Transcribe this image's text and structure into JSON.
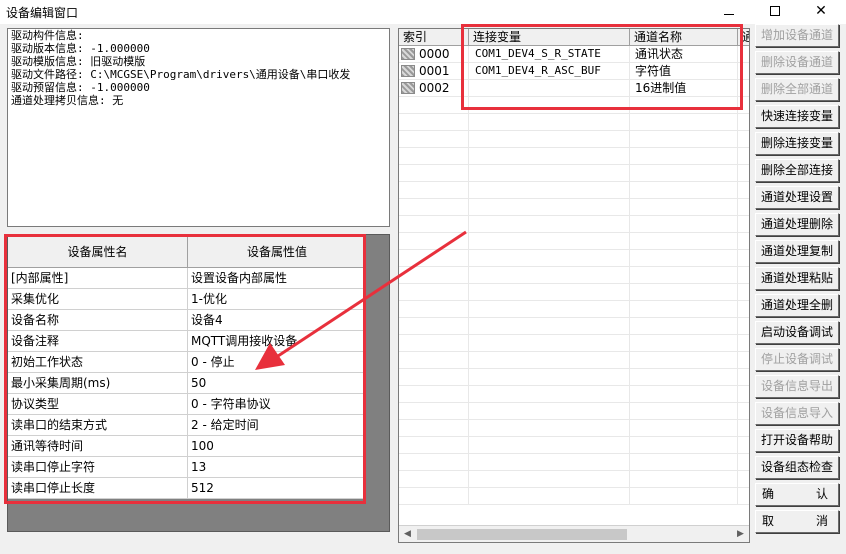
{
  "window": {
    "title": "设备编辑窗口",
    "minimize": "—",
    "close": "✕"
  },
  "info": {
    "lines": [
      "驱动构件信息:",
      "驱动版本信息: -1.000000",
      "驱动模版信息: 旧驱动模版",
      "驱动文件路径: C:\\MCGSE\\Program\\drivers\\通用设备\\串口收发",
      "驱动预留信息: -1.000000",
      "通道处理拷贝信息: 无"
    ]
  },
  "properties": {
    "header": {
      "name": "设备属性名",
      "value": "设备属性值"
    },
    "rows": [
      {
        "name": "[内部属性]",
        "value": "设置设备内部属性"
      },
      {
        "name": "采集优化",
        "value": "1-优化"
      },
      {
        "name": "设备名称",
        "value": "设备4"
      },
      {
        "name": "设备注释",
        "value": "MQTT调用接收设备"
      },
      {
        "name": "初始工作状态",
        "value": "0 - 停止"
      },
      {
        "name": "最小采集周期(ms)",
        "value": "50"
      },
      {
        "name": "协议类型",
        "value": "0 - 字符串协议"
      },
      {
        "name": "读串口的结束方式",
        "value": "2 - 给定时间"
      },
      {
        "name": "通讯等待时间",
        "value": "100"
      },
      {
        "name": "读串口停止字符",
        "value": "13"
      },
      {
        "name": "读串口停止长度",
        "value": "512"
      }
    ]
  },
  "channels": {
    "header": {
      "index": "索引",
      "variable": "连接变量",
      "name": "通道名称",
      "more": "通"
    },
    "rows": [
      {
        "index": "0000",
        "variable": "COM1_DEV4_S_R_STATE",
        "name": "通讯状态"
      },
      {
        "index": "0001",
        "variable": "COM1_DEV4_R_ASC_BUF",
        "name": "字符值"
      },
      {
        "index": "0002",
        "variable": "",
        "name": "16进制值"
      }
    ]
  },
  "buttons": [
    {
      "label": "增加设备通道",
      "enabled": false
    },
    {
      "label": "删除设备通道",
      "enabled": false
    },
    {
      "label": "删除全部通道",
      "enabled": false
    },
    {
      "label": "快速连接变量",
      "enabled": true
    },
    {
      "label": "删除连接变量",
      "enabled": true
    },
    {
      "label": "删除全部连接",
      "enabled": true
    },
    {
      "label": "通道处理设置",
      "enabled": true
    },
    {
      "label": "通道处理删除",
      "enabled": true
    },
    {
      "label": "通道处理复制",
      "enabled": true
    },
    {
      "label": "通道处理粘贴",
      "enabled": true
    },
    {
      "label": "通道处理全删",
      "enabled": true
    },
    {
      "label": "启动设备调试",
      "enabled": true
    },
    {
      "label": "停止设备调试",
      "enabled": false
    },
    {
      "label": "设备信息导出",
      "enabled": false
    },
    {
      "label": "设备信息导入",
      "enabled": false
    },
    {
      "label": "打开设备帮助",
      "enabled": true
    },
    {
      "label": "设备组态检查",
      "enabled": true
    }
  ],
  "confirm": {
    "left": "确",
    "right": "认"
  },
  "cancel": {
    "left": "取",
    "right": "消"
  },
  "colors": {
    "highlight": "#e8303c",
    "panel_gray": "#808080",
    "window_bg": "#f0f0f0"
  }
}
